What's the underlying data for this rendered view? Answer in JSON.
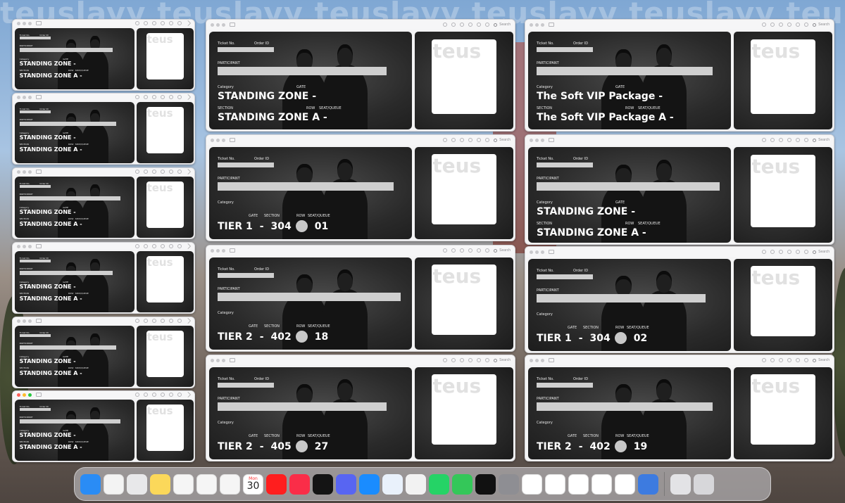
{
  "watermark": "teuslayy teuslayy teuslayy teuslayy teuslayy teuslayy teuslayy",
  "toolbar": {
    "search_label": "Search"
  },
  "labels": {
    "ticket_no": "Ticket No.",
    "order_id": "Order ID",
    "participant": "PARTICIPANT",
    "category": "Category",
    "gate": "GATE",
    "section": "SECTION",
    "row": "ROW",
    "seat": "SEAT/QUEUE"
  },
  "overlay": {
    "qr_watermark": "teus"
  },
  "windows": [
    {
      "id": "s1",
      "category": "STANDING ZONE -",
      "line2": "STANDING ZONE  A  -"
    },
    {
      "id": "s2",
      "category": "STANDING ZONE -",
      "line2": "STANDING ZONE  A  -"
    },
    {
      "id": "s3",
      "category": "STANDING ZONE -",
      "line2": "STANDING ZONE  A  -"
    },
    {
      "id": "s4",
      "category": "STANDING ZONE -",
      "line2": "STANDING ZONE  A  -"
    },
    {
      "id": "s5",
      "category": "STANDING ZONE -",
      "line2": "STANDING ZONE  A  -"
    },
    {
      "id": "s6",
      "category": "STANDING ZONE -",
      "line2": "STANDING ZONE  A  -"
    },
    {
      "id": "m1",
      "category": "STANDING ZONE  -",
      "line2": "STANDING ZONE  A  -"
    },
    {
      "id": "m2",
      "tier": "TIER 1",
      "sep": "-",
      "section": "304",
      "seat": "01"
    },
    {
      "id": "m3",
      "tier": "TIER 2",
      "sep": "-",
      "section": "402",
      "seat": "18"
    },
    {
      "id": "m4",
      "tier": "TIER 2",
      "sep": "-",
      "section": "405",
      "seat": "27"
    },
    {
      "id": "r1",
      "category": "The Soft VIP Package  -",
      "line2": "The Soft VIP Package  A  -"
    },
    {
      "id": "r2",
      "category": "STANDING ZONE  -",
      "line2": "STANDING ZONE  A  -"
    },
    {
      "id": "r3",
      "tier": "TIER 1",
      "sep": "-",
      "section": "304",
      "seat": "02"
    },
    {
      "id": "r4",
      "tier": "TIER 2",
      "sep": "-",
      "section": "402",
      "seat": "19"
    }
  ],
  "dock": {
    "calendar_day": "30",
    "calendar_month": "Mon",
    "apps": [
      {
        "name": "finder-icon",
        "color": "#2a8cf5"
      },
      {
        "name": "photos-icon",
        "color": "#f3f3f3"
      },
      {
        "name": "launchpad-icon",
        "color": "#e8e8ea"
      },
      {
        "name": "notes-icon",
        "color": "#fbd85a"
      },
      {
        "name": "chrome-icon",
        "color": "#f5f5f5"
      },
      {
        "name": "gemini-icon",
        "color": "#f5f5f5"
      },
      {
        "name": "gmail-icon",
        "color": "#f5f5f5"
      },
      {
        "name": "calendar-icon",
        "color": "#ffffff"
      },
      {
        "name": "youtube-icon",
        "color": "#ff1e1e"
      },
      {
        "name": "music-icon",
        "color": "#fa2d48"
      },
      {
        "name": "netflix-icon",
        "color": "#141414"
      },
      {
        "name": "discord-icon",
        "color": "#5865f2"
      },
      {
        "name": "app-store-icon",
        "color": "#1a8cff"
      },
      {
        "name": "safari-icon",
        "color": "#e9f1fb"
      },
      {
        "name": "freeform-icon",
        "color": "#f2f2f2"
      },
      {
        "name": "whatsapp-icon",
        "color": "#25d366"
      },
      {
        "name": "messages-icon",
        "color": "#34c759"
      },
      {
        "name": "spotify-icon",
        "color": "#111111"
      },
      {
        "name": "system-settings-icon",
        "color": "#8e8e93"
      },
      {
        "name": "powerpoint-icon",
        "color": "#ffffff"
      },
      {
        "name": "onenote-icon",
        "color": "#ffffff"
      },
      {
        "name": "word-icon",
        "color": "#ffffff"
      },
      {
        "name": "outlook-icon",
        "color": "#ffffff"
      },
      {
        "name": "excel-icon",
        "color": "#ffffff"
      },
      {
        "name": "preview-icon",
        "color": "#3d7be0"
      },
      {
        "name": "downloads-icon",
        "color": "#e3e3e6"
      },
      {
        "name": "trash-icon",
        "color": "#d7d7da"
      }
    ]
  }
}
